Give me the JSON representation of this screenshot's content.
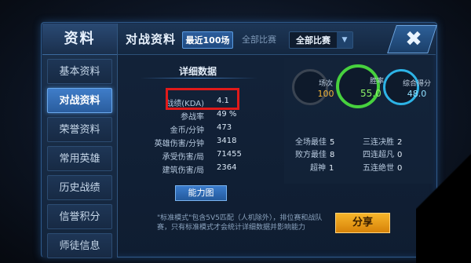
{
  "sidebar": {
    "title": "资料",
    "items": [
      {
        "label": "基本资料",
        "active": false
      },
      {
        "label": "对战资料",
        "active": true
      },
      {
        "label": "荣誉资料",
        "active": false
      },
      {
        "label": "常用英雄",
        "active": false
      },
      {
        "label": "历史战绩",
        "active": false
      },
      {
        "label": "信誉积分",
        "active": false
      },
      {
        "label": "师徒信息",
        "active": false
      }
    ]
  },
  "header": {
    "title": "对战资料",
    "tabs": [
      {
        "label": "最近100场",
        "active": true
      },
      {
        "label": "全部比赛",
        "active": false
      }
    ],
    "dropdown_value": "全部比赛",
    "close_icon": "close-icon"
  },
  "detail": {
    "title": "详细数据",
    "stats": [
      {
        "label": "战绩(KDA)",
        "value": "4.1"
      },
      {
        "label": "参战率",
        "value": "49 %"
      },
      {
        "label": "金币/分钟",
        "value": "473"
      },
      {
        "label": "英雄伤害/分钟",
        "value": "3418"
      },
      {
        "label": "承受伤害/局",
        "value": "71455"
      },
      {
        "label": "建筑伤害/局",
        "value": "2364"
      }
    ],
    "ability_button": "能力图"
  },
  "summary": {
    "matches": {
      "label": "场次",
      "value": "100"
    },
    "winrate": {
      "label": "胜率",
      "value": "55.0 %"
    },
    "score": {
      "label": "综合得分",
      "value": "48.0"
    },
    "colors": {
      "matches": "#f2b437",
      "winrate": "#47d13e",
      "score": "#2db3e6"
    }
  },
  "bests": [
    {
      "label": "全场最佳",
      "value": "5"
    },
    {
      "label": "三连决胜",
      "value": "2"
    },
    {
      "label": "败方最佳",
      "value": "8"
    },
    {
      "label": "四连超凡",
      "value": "0"
    },
    {
      "label": "超神",
      "value": "1"
    },
    {
      "label": "五连绝世",
      "value": "0"
    }
  ],
  "footer": {
    "note": "\"标准模式\"包含5V5匹配（人机除外），排位赛和战队赛，只有标准模式才会统计详细数据并影响能力",
    "share_button": "分享"
  }
}
